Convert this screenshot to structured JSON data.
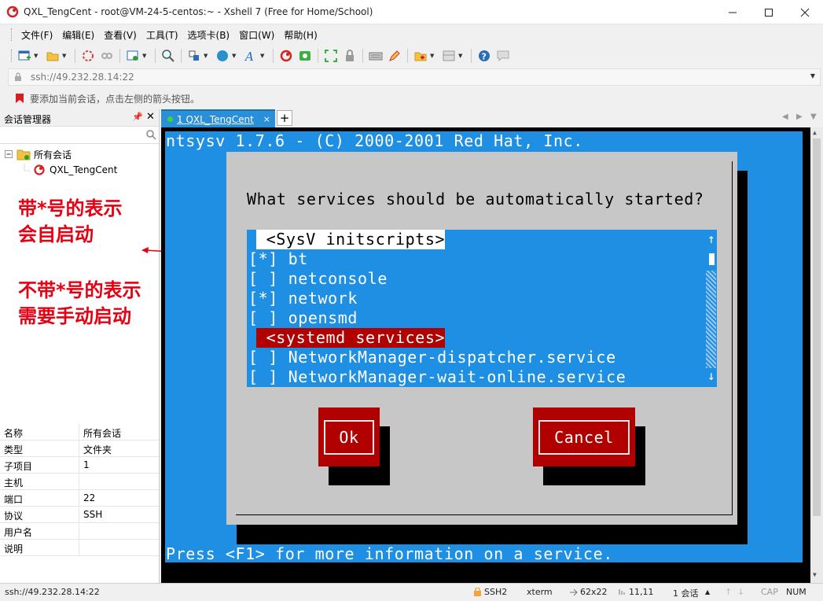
{
  "window": {
    "title": "QXL_TengCent - root@VM-24-5-centos:~ - Xshell 7 (Free for Home/School)"
  },
  "menu": [
    "文件(F)",
    "编辑(E)",
    "查看(V)",
    "工具(T)",
    "选项卡(B)",
    "窗口(W)",
    "帮助(H)"
  ],
  "address": {
    "value": "ssh://49.232.28.14:22"
  },
  "hint": {
    "text": "要添加当前会话，点击左侧的箭头按钮。"
  },
  "session_manager": {
    "title": "会话管理器",
    "tree_root": "所有会话",
    "tree_child": "QXL_TengCent",
    "properties": [
      {
        "key": "名称",
        "value": "所有会话"
      },
      {
        "key": "类型",
        "value": "文件夹"
      },
      {
        "key": "子项目",
        "value": "1"
      },
      {
        "key": "主机",
        "value": ""
      },
      {
        "key": "端口",
        "value": "22"
      },
      {
        "key": "协议",
        "value": "SSH"
      },
      {
        "key": "用户名",
        "value": ""
      },
      {
        "key": "说明",
        "value": ""
      }
    ]
  },
  "annotation": {
    "line1": "带*号的表示",
    "line2": "会自启动",
    "line3": "不带*号的表示",
    "line4": "需要手动启动",
    "color": "#e60012"
  },
  "tab": {
    "label": "1 QXL_TengCent",
    "close": "×",
    "add": "+"
  },
  "terminal": {
    "header": "ntsysv 1.7.6 - (C) 2000-2001 Red Hat, Inc.",
    "question": "What services should be automatically started?",
    "list": [
      {
        "text": " <SysV initscripts>",
        "style": "highlight"
      },
      {
        "text": "[*] bt",
        "style": "normal"
      },
      {
        "text": "[ ] netconsole",
        "style": "normal"
      },
      {
        "text": "[*] network",
        "style": "normal"
      },
      {
        "text": "[ ] opensmd",
        "style": "normal"
      },
      {
        "text": " <systemd services>",
        "style": "red"
      },
      {
        "text": "[ ] NetworkManager-dispatcher.service",
        "style": "normal"
      },
      {
        "text": "[ ] NetworkManager-wait-online.service",
        "style": "normal"
      }
    ],
    "ok_button": "Ok",
    "cancel_button": "Cancel",
    "footer": "Press <F1> for more information on a service.",
    "bg_color": "#1e8fe3",
    "dialog_color": "#c7c7c7",
    "button_color": "#b00000"
  },
  "status": {
    "address": "ssh://49.232.28.14:22",
    "protocol": "SSH2",
    "term": "xterm",
    "size": "62x22",
    "cursor": "11,11",
    "sessions": "1 会话",
    "cap": "CAP",
    "num": "NUM"
  }
}
